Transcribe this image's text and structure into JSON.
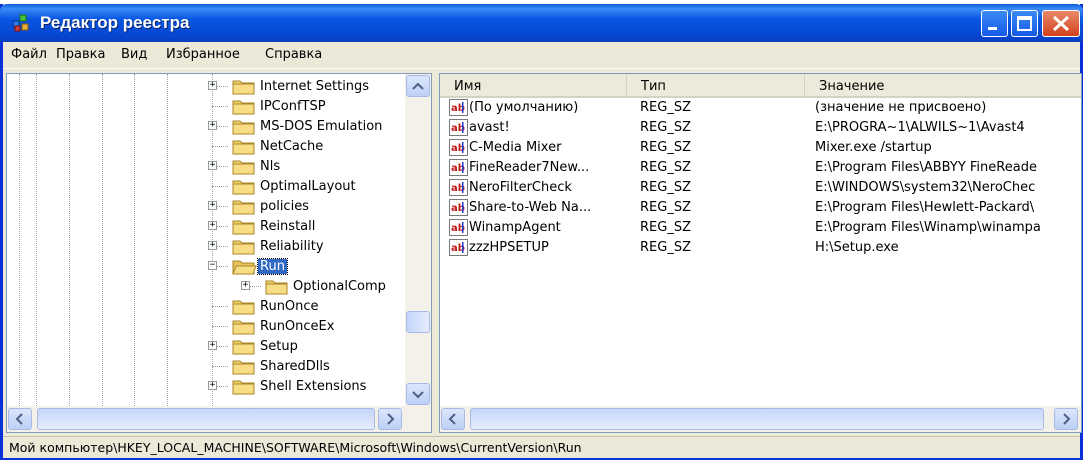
{
  "window": {
    "title": "Редактор реестра",
    "icons": {
      "app": "registry-editor-icon",
      "minimize": "minimize-icon",
      "maximize": "maximize-icon",
      "close": "close-icon"
    }
  },
  "menu": [
    "Файл",
    "Правка",
    "Вид",
    "Избранное",
    "Справка"
  ],
  "tree": {
    "items": [
      {
        "label": "Internet Settings",
        "expander": "+",
        "depth": 0
      },
      {
        "label": "IPConfTSP",
        "expander": "",
        "depth": 0
      },
      {
        "label": "MS-DOS Emulation",
        "expander": "+",
        "depth": 0
      },
      {
        "label": "NetCache",
        "expander": "",
        "depth": 0
      },
      {
        "label": "Nls",
        "expander": "+",
        "depth": 0
      },
      {
        "label": "OptimalLayout",
        "expander": "",
        "depth": 0
      },
      {
        "label": "policies",
        "expander": "+",
        "depth": 0
      },
      {
        "label": "Reinstall",
        "expander": "+",
        "depth": 0
      },
      {
        "label": "Reliability",
        "expander": "+",
        "depth": 0
      },
      {
        "label": "Run",
        "expander": "−",
        "depth": 0,
        "selected": true
      },
      {
        "label": "OptionalComp",
        "expander": "+",
        "depth": 1
      },
      {
        "label": "RunOnce",
        "expander": "",
        "depth": 0
      },
      {
        "label": "RunOnceEx",
        "expander": "",
        "depth": 0
      },
      {
        "label": "Setup",
        "expander": "+",
        "depth": 0
      },
      {
        "label": "SharedDlls",
        "expander": "",
        "depth": 0
      },
      {
        "label": "Shell Extensions",
        "expander": "+",
        "depth": 0
      }
    ]
  },
  "list": {
    "columns": [
      "Имя",
      "Тип",
      "Значение"
    ],
    "rows": [
      {
        "name": "(По умолчанию)",
        "type": "REG_SZ",
        "value": "(значение не присвоено)"
      },
      {
        "name": "avast!",
        "type": "REG_SZ",
        "value": "E:\\PROGRA~1\\ALWILS~1\\Avast4"
      },
      {
        "name": "C-Media Mixer",
        "type": "REG_SZ",
        "value": "Mixer.exe /startup"
      },
      {
        "name": "FineReader7New...",
        "type": "REG_SZ",
        "value": "E:\\Program Files\\ABBYY FineReade"
      },
      {
        "name": "NeroFilterCheck",
        "type": "REG_SZ",
        "value": "E:\\WINDOWS\\system32\\NeroChec"
      },
      {
        "name": "Share-to-Web Na...",
        "type": "REG_SZ",
        "value": "E:\\Program Files\\Hewlett-Packard\\"
      },
      {
        "name": "WinampAgent",
        "type": "REG_SZ",
        "value": "E:\\Program Files\\Winamp\\winampa"
      },
      {
        "name": "zzzHPSETUP",
        "type": "REG_SZ",
        "value": "H:\\Setup.exe"
      }
    ]
  },
  "status": "Мой компьютер\\HKEY_LOCAL_MACHINE\\SOFTWARE\\Microsoft\\Windows\\CurrentVersion\\Run",
  "colors": {
    "titlebar": "#0857e3",
    "selection": "#316ac5",
    "folder": "#f1d36b"
  }
}
